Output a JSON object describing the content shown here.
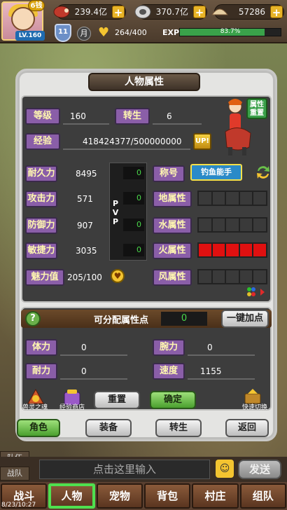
{
  "topbar": {
    "vip": "6钱",
    "level": "LV.160",
    "resources": [
      {
        "name": "meat",
        "value": "239.4亿"
      },
      {
        "name": "silver",
        "value": "370.7亿"
      },
      {
        "name": "shell",
        "value": "57286"
      }
    ],
    "rank": "11",
    "month": "月",
    "stamina": "264/400",
    "exp_label": "EXP",
    "exp_progress": 0.837,
    "exp_text": "83.7%"
  },
  "panel": {
    "title": "人物属性",
    "attr_switch": "属性\n重置",
    "level_label": "等级",
    "level_value": "160",
    "rebirth_label": "转生",
    "rebirth_value": "6",
    "exp_label": "经验",
    "exp_value": "418424377/500000000",
    "up_btn": "UP!",
    "stats": [
      {
        "label": "耐久力",
        "value": "8495",
        "pvp": "0"
      },
      {
        "label": "攻击力",
        "value": "571",
        "pvp": "0"
      },
      {
        "label": "防御力",
        "value": "907",
        "pvp": "0"
      },
      {
        "label": "敏捷力",
        "value": "3035",
        "pvp": "0"
      }
    ],
    "pvp": "PVP",
    "title_label": "称号",
    "title_value": "钓鱼能手",
    "charm_label": "魅力值",
    "charm_value": "205/100",
    "elements": [
      {
        "label": "地属性",
        "fill": 0
      },
      {
        "label": "水属性",
        "fill": 0
      },
      {
        "label": "火属性",
        "fill": 1
      },
      {
        "label": "风属性",
        "fill": 0
      }
    ]
  },
  "distribute": {
    "label": "可分配属性点",
    "value": "0",
    "auto_btn": "一键加点",
    "items": [
      {
        "label": "体力",
        "value": "0"
      },
      {
        "label": "腕力",
        "value": "0"
      },
      {
        "label": "耐力",
        "value": "0"
      },
      {
        "label": "速度",
        "value": "1155"
      }
    ],
    "soul_label": "兽灵之魂",
    "shop_label": "经验商店",
    "reset_btn": "重置",
    "confirm_btn": "确定",
    "switch_label": "快速切换"
  },
  "tabs": [
    "角色",
    "装备",
    "转生",
    "返回"
  ],
  "side": {
    "team": "队伍",
    "battle_team": "战队"
  },
  "chat": {
    "placeholder": "点击这里输入",
    "send": "发送"
  },
  "nav": [
    "战斗",
    "人物",
    "宠物",
    "背包",
    "村庄",
    "组队"
  ],
  "clock": "8/23/10:27"
}
